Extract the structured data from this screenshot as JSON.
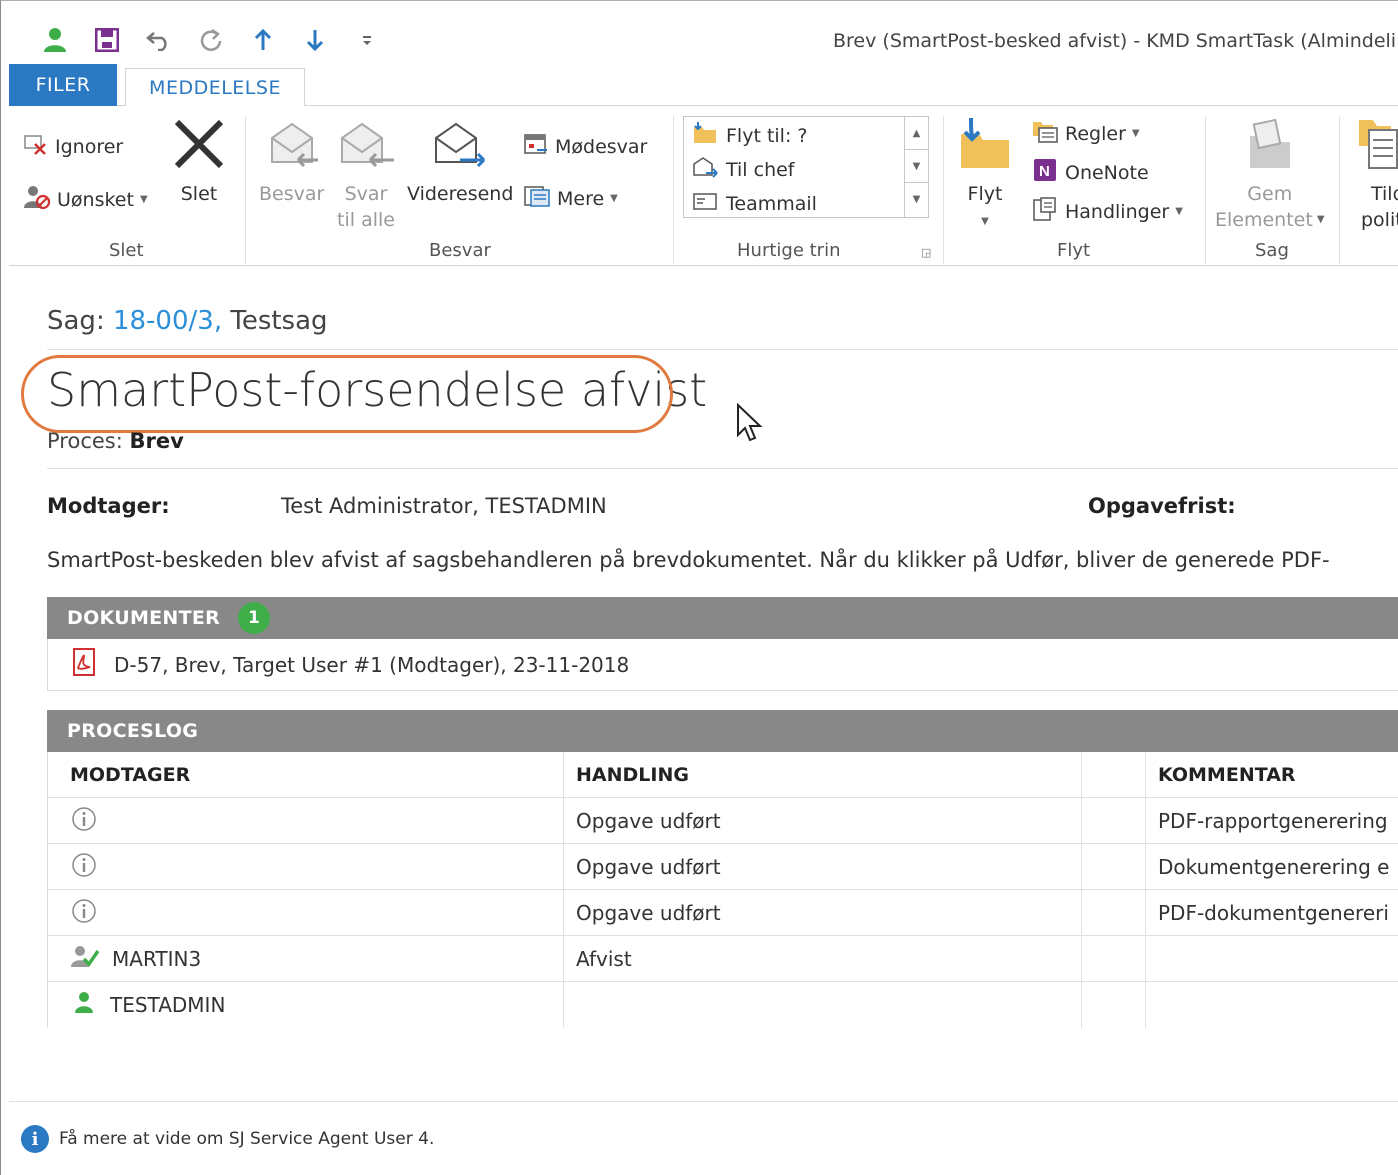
{
  "window": {
    "title": "Brev (SmartPost-besked afvist) - KMD SmartTask (Almindeli"
  },
  "qat": {
    "items": [
      "person-icon",
      "save-icon",
      "undo-icon",
      "redo-icon",
      "up-arrow-icon",
      "down-arrow-icon",
      "customize-icon"
    ]
  },
  "tabs": {
    "filer": "FILER",
    "meddelelse": "MEDDELELSE"
  },
  "ribbon": {
    "slet": {
      "label": "Slet",
      "ignorer": "Ignorer",
      "uonsket": "Uønsket",
      "slet_button": "Slet"
    },
    "besvar": {
      "label": "Besvar",
      "besvar_button": "Besvar",
      "svar_til_alle_1": "Svar",
      "svar_til_alle_2": "til alle",
      "videresend": "Videresend",
      "modesvar": "Mødesvar",
      "mere": "Mere"
    },
    "hurtige_trin": {
      "label": "Hurtige trin",
      "items": [
        "Flyt til: ?",
        "Til chef",
        "Teammail"
      ]
    },
    "flyt": {
      "label": "Flyt",
      "flyt_button": "Flyt",
      "regler": "Regler",
      "onenote": "OneNote",
      "handlinger": "Handlinger"
    },
    "sag": {
      "label": "Sag",
      "gem_1": "Gem",
      "gem_2": "Elementet"
    },
    "tild": {
      "line1": "Tild",
      "line2": "politi"
    }
  },
  "content": {
    "sag_prefix": "Sag:",
    "sag_number": "18-00/3,",
    "sag_name": "Testsag",
    "heading": "SmartPost-forsendelse afvist",
    "proces_label": "Proces:",
    "proces_value": "Brev",
    "modtager_label": "Modtager:",
    "modtager_value": "Test Administrator, TESTADMIN",
    "opgavefrist_label": "Opgavefrist:",
    "description": "SmartPost-beskeden blev afvist af sagsbehandleren på brevdokumentet. Når du klikker på Udfør, bliver de generede PDF-"
  },
  "dokumenter": {
    "header": "DOKUMENTER",
    "count": "1",
    "items": [
      "D-57, Brev, Target User #1 (Modtager), 23-11-2018"
    ]
  },
  "proceslog": {
    "header": "PROCESLOG",
    "columns": [
      "MODTAGER",
      "HANDLING",
      "KOMMENTAR"
    ],
    "rows": [
      {
        "icon": "info-icon",
        "modtager": "",
        "handling": "Opgave udført",
        "kommentar": "PDF-rapportgenerering"
      },
      {
        "icon": "info-icon",
        "modtager": "",
        "handling": "Opgave udført",
        "kommentar": "Dokumentgenerering e"
      },
      {
        "icon": "info-icon",
        "modtager": "",
        "handling": "Opgave udført",
        "kommentar": "PDF-dokumentgenereri"
      },
      {
        "icon": "user-check-icon",
        "modtager": "MARTIN3",
        "handling": "Afvist",
        "kommentar": ""
      },
      {
        "icon": "user-icon",
        "modtager": "TESTADMIN",
        "handling": "",
        "kommentar": ""
      }
    ]
  },
  "footer": {
    "text": "Få mere at vide om SJ Service Agent User 4."
  },
  "colors": {
    "accent": "#2b79c2",
    "link": "#2b90d9",
    "highlight_oval": "#e07a3e",
    "section_header": "#888888",
    "badge": "#3fae49"
  }
}
